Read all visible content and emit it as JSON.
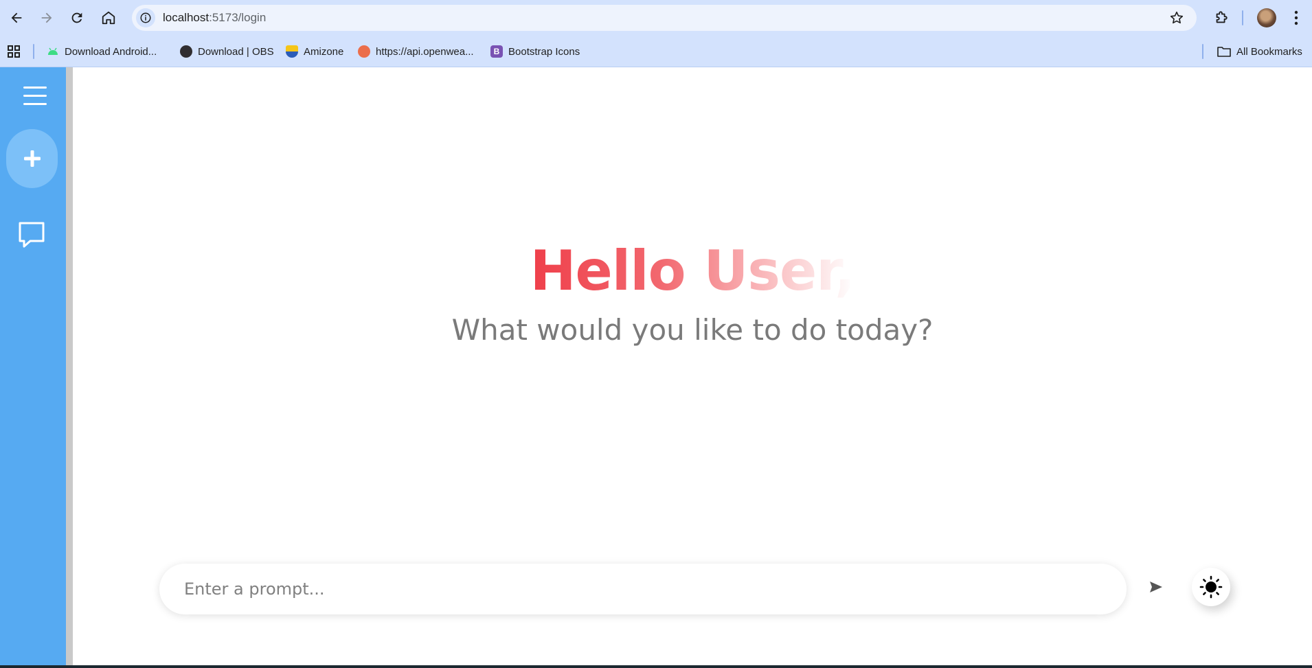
{
  "browser": {
    "url_host": "localhost",
    "url_path": ":5173/login",
    "bookmarks": [
      {
        "label": "Download Android...",
        "icon": "android-icon",
        "color": "#3ddc84"
      },
      {
        "label": "Download | OBS",
        "icon": "obs-icon",
        "color": "#302e31"
      },
      {
        "label": "Amizone",
        "icon": "amizone-shield-icon",
        "color": "#f5c518"
      },
      {
        "label": "https://api.openwea...",
        "icon": "openweather-icon",
        "color": "#eb6e4b"
      },
      {
        "label": "Bootstrap Icons",
        "icon": "bootstrap-icon",
        "color": "#7952b3"
      }
    ],
    "all_bookmarks_label": "All Bookmarks"
  },
  "sidebar": {
    "menu_icon": "hamburger-menu-icon",
    "new_chat_icon": "plus-icon",
    "recent_icon": "chat-bubble-icon",
    "color": "#56aaf2"
  },
  "main": {
    "greeting": "Hello User,",
    "subtitle": "What would you like to do today?",
    "greeting_color": "#ef3f4a"
  },
  "prompt": {
    "placeholder": "Enter a prompt...",
    "value": "",
    "send_icon": "send-icon",
    "theme_icon": "sun-icon"
  }
}
